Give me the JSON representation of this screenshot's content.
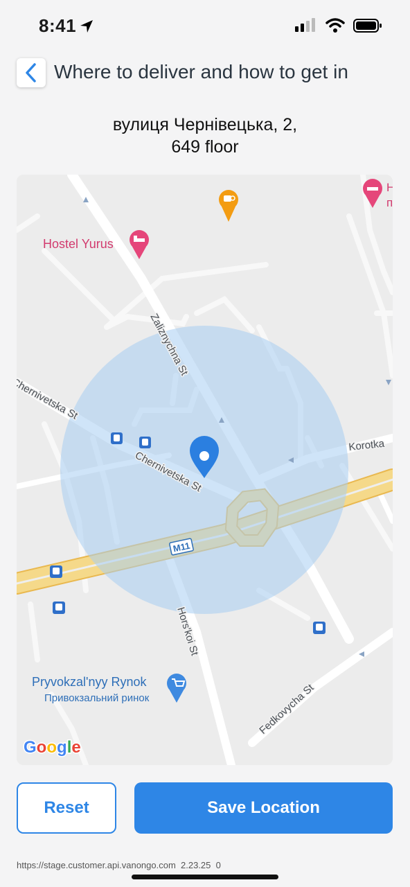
{
  "status_bar": {
    "time": "8:41"
  },
  "header": {
    "title": "Where to deliver and how to get in"
  },
  "address": {
    "line1": "вулиця Чернівецька, 2,",
    "line2": "649 floor"
  },
  "map": {
    "streets": {
      "zaliznychna": "Zaliznychna St",
      "chernivetska_left": "Chernivetska St",
      "chernivetska_center": "Chernivetska St",
      "korotka": "Korotka",
      "horskoi": "Hors'koi St",
      "fedkovycha": "Fedkovycha St",
      "highway": "M11"
    },
    "places": {
      "hostel": "Hostel Yurus",
      "hostel_partial_1": "H",
      "hostel_partial_2": "п",
      "market_en": "Pryvokzal'nyy Rynok",
      "market_uk": "Привокзальний ринок"
    },
    "attribution": {
      "g": "G",
      "o1": "o",
      "o2": "o",
      "g2": "g",
      "l": "l",
      "e": "e"
    },
    "colors": {
      "radius_fill": "#a8cdf3",
      "pin": "#2b7fe0",
      "highway": "#f3d27d"
    }
  },
  "buttons": {
    "reset": "Reset",
    "save": "Save Location"
  },
  "footer": {
    "text": "https://stage.customer.api.vanongo.com  2.23.25  0"
  }
}
